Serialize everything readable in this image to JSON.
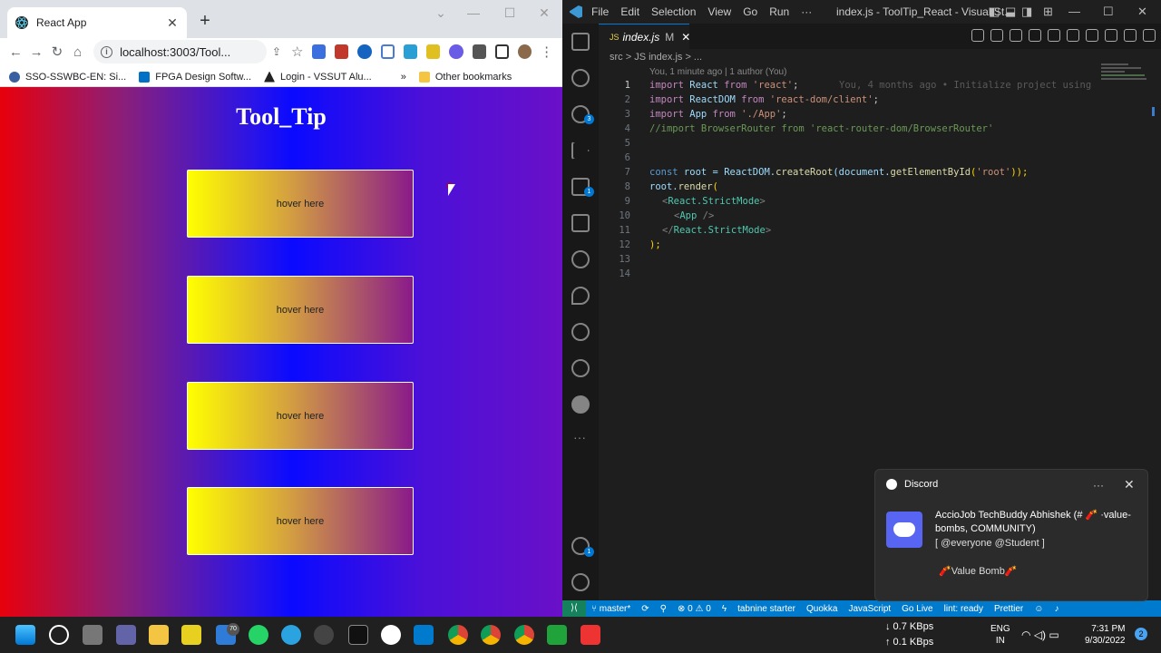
{
  "browser": {
    "tab_title": "React App",
    "url": "localhost:3003/Tool...",
    "bookmarks": [
      "SSO-SSWBC-EN: Si...",
      "FPGA Design Softw...",
      "Login - VSSUT Alu..."
    ],
    "other_bookmarks": "Other bookmarks",
    "page": {
      "heading": "Tool_Tip",
      "boxes": [
        "hover here",
        "hover here",
        "hover here",
        "hover here"
      ]
    }
  },
  "vscode": {
    "menu": [
      "File",
      "Edit",
      "Selection",
      "View",
      "Go",
      "Run",
      "···"
    ],
    "window_title": "index.js - ToolTip_React - Visual St...",
    "tab": {
      "filename": "index.js",
      "modified": "M"
    },
    "breadcrumb": "src  >  JS index.js  >  ...",
    "blame": "You, 1 minute ago | 1 author (You)",
    "ghost_text": "You, 4 months ago • Initialize project using",
    "line_numbers": [
      "1",
      "2",
      "3",
      "4",
      "5",
      "6",
      "7",
      "8",
      "9",
      "10",
      "11",
      "12",
      "13",
      "14"
    ],
    "code": {
      "l1": [
        "import",
        " React ",
        "from",
        " 'react'",
        ";"
      ],
      "l2": [
        "import",
        " ReactDOM ",
        "from",
        " 'react-dom/client'",
        ";"
      ],
      "l3": [
        "import",
        " App ",
        "from",
        " './App'",
        ";"
      ],
      "l4": "//import BrowserRouter from 'react-router-dom/BrowserRouter'",
      "l7": [
        "const",
        " root ",
        "= ReactDOM.",
        "createRoot",
        "(document.",
        "getElementById",
        "(",
        "'root'",
        "));"
      ],
      "l8": [
        "root.",
        "render",
        "("
      ],
      "l9": [
        "<",
        "React.StrictMode",
        ">"
      ],
      "l10": [
        "<",
        "App",
        " />"
      ],
      "l11": [
        "</",
        "React.StrictMode",
        ">"
      ],
      "l12": ");"
    },
    "status": {
      "branch": "master*",
      "problems": "⊗ 0 ⚠ 0",
      "tabnine": "tabnine starter",
      "quokka": "Quokka",
      "language": "JavaScript",
      "golive": "Go Live",
      "lint": "lint: ready",
      "prettier": "Prettier"
    },
    "activity_badges": {
      "scm": "3",
      "extensions": "1",
      "accounts": "1"
    }
  },
  "discord_toast": {
    "app": "Discord",
    "title": "AccioJob TechBuddy Abhishek (# 🧨 ·value-bombs, COMMUNITY)",
    "subtitle": "[ @everyone  @Student ]",
    "message": "🧨Value Bomb🧨"
  },
  "taskbar": {
    "net_down": "↓ 0.7 KBps",
    "net_up": "↑ 0.1 KBps",
    "lang1": "ENG",
    "lang2": "IN",
    "time": "7:31 PM",
    "date": "9/30/2022",
    "mail_badge": "70",
    "notif_count": "2"
  }
}
